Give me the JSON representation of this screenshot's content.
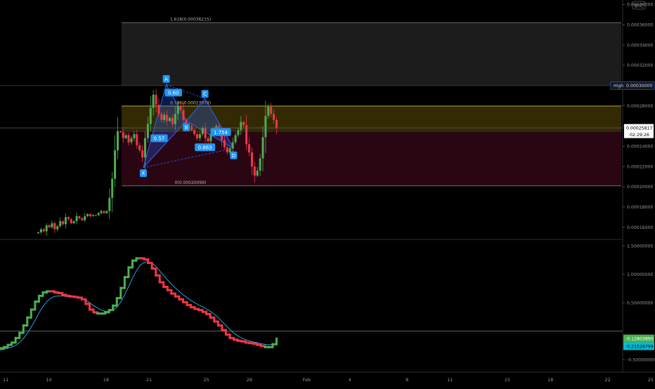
{
  "chart_data": [
    {
      "type": "candlestick",
      "panel": "price",
      "currency_badge": "BTC",
      "y_ticks": [
        "0.00038000",
        "0.00036000",
        "0.00034000",
        "0.00032000",
        "0.00028000",
        "0.00026000",
        "0.00024000",
        "0.00022000",
        "0.00020000",
        "0.00018000",
        "0.00016000"
      ],
      "ylim": [
        0.000148,
        0.0003845
      ],
      "grid": false,
      "current_price": "0.00025817",
      "current_value": 0.00025817,
      "countdown": "02:29:26",
      "high_label": "High",
      "high_price": "0.00030000",
      "high_value": 0.0003,
      "fib_levels": [
        {
          "label": "1.618(0.00036215)",
          "value": 0.00036215
        },
        {
          "label": "0.786(0.00027978)",
          "value": 0.00027978
        },
        {
          "label": "0(0.00020099)",
          "value": 0.00020099
        }
      ],
      "harmonic_points": [
        {
          "label": "X",
          "x": 20.6,
          "y": 0.000219
        },
        {
          "label": "A",
          "x": 22.2,
          "y": 0.000301
        },
        {
          "label": "B",
          "x": 23.6,
          "y": 0.000265
        },
        {
          "label": "C",
          "x": 24.9,
          "y": 0.000287
        },
        {
          "label": "D",
          "x": 26.9,
          "y": 0.000238
        }
      ],
      "harmonic_ratios": [
        {
          "label": "0.60",
          "x": 22.7,
          "y": 0.000293
        },
        {
          "label": "0.57",
          "x": 21.7,
          "y": 0.000248
        },
        {
          "label": "0.863",
          "x": 24.9,
          "y": 0.000239
        },
        {
          "label": "1.754",
          "x": 26.0,
          "y": 0.000254
        }
      ],
      "closes": [
        0.000155,
        0.000158,
        0.000156,
        0.000162,
        0.00016,
        0.000164,
        0.000158,
        0.000161,
        0.000166,
        0.000163,
        0.00017,
        0.000168,
        0.000164,
        0.000166,
        0.000171,
        0.000169,
        0.000167,
        0.000171,
        0.000173,
        0.000171,
        0.000172,
        0.000172,
        0.000174,
        0.000176,
        0.000174,
        0.000176,
        0.000189,
        0.000208,
        0.000236,
        0.000255,
        0.000254,
        0.000248,
        0.000251,
        0.000244,
        0.000248,
        0.000252,
        0.000241,
        0.000236,
        0.000229,
        0.000248,
        0.000262,
        0.000278,
        0.000291,
        0.000281,
        0.000272,
        0.000266,
        0.000271,
        0.000265,
        0.000268,
        0.000262,
        0.000272,
        0.00028,
        0.000276,
        0.000266,
        0.000261,
        0.00026,
        0.000256,
        0.000252,
        0.000248,
        0.000252,
        0.000258,
        0.000248,
        0.000245,
        0.000252,
        0.000257,
        0.00026,
        0.000254,
        0.000246,
        0.000239,
        0.000234,
        0.000238,
        0.000244,
        0.000251,
        0.000256,
        0.000264,
        0.000261,
        0.000242,
        0.000234,
        0.00022,
        0.000211,
        0.000216,
        0.000228,
        0.000249,
        0.00027,
        0.000279,
        0.000272,
        0.000266,
        0.000258
      ]
    },
    {
      "type": "line",
      "panel": "oscillator",
      "y_ticks": [
        "1.50000000",
        "1.00000000",
        "0.50000000",
        "-0.50000000"
      ],
      "ylim": [
        -0.72,
        1.6
      ],
      "zero_value": 0,
      "series": [
        {
          "role": "main",
          "color_up": "#4caf50",
          "color_down": "#f23645",
          "values": [
            -0.3,
            -0.28,
            -0.24,
            -0.2,
            -0.12,
            -0.03,
            0.1,
            0.24,
            0.38,
            0.52,
            0.62,
            0.68,
            0.7,
            0.7,
            0.68,
            0.67,
            0.64,
            0.62,
            0.61,
            0.6,
            0.59,
            0.56,
            0.48,
            0.38,
            0.33,
            0.31,
            0.31,
            0.33,
            0.37,
            0.45,
            0.58,
            0.76,
            0.95,
            1.12,
            1.24,
            1.28,
            1.28,
            1.26,
            1.2,
            1.1,
            0.98,
            0.86,
            0.78,
            0.72,
            0.66,
            0.61,
            0.56,
            0.51,
            0.46,
            0.42,
            0.39,
            0.37,
            0.34,
            0.3,
            0.24,
            0.17,
            0.1,
            0.02,
            -0.06,
            -0.12,
            -0.15,
            -0.17,
            -0.18,
            -0.2,
            -0.21,
            -0.22,
            -0.24,
            -0.26,
            -0.28,
            -0.28,
            -0.23,
            -0.13
          ]
        },
        {
          "role": "signal",
          "color": "#29b6f6",
          "values": [
            -0.33,
            -0.32,
            -0.3,
            -0.28,
            -0.25,
            -0.2,
            -0.13,
            -0.04,
            0.07,
            0.19,
            0.32,
            0.43,
            0.52,
            0.58,
            0.61,
            0.62,
            0.62,
            0.61,
            0.6,
            0.6,
            0.59,
            0.58,
            0.55,
            0.5,
            0.45,
            0.41,
            0.37,
            0.35,
            0.35,
            0.37,
            0.42,
            0.51,
            0.64,
            0.78,
            0.93,
            1.06,
            1.16,
            1.21,
            1.22,
            1.2,
            1.14,
            1.06,
            0.98,
            0.9,
            0.83,
            0.76,
            0.7,
            0.64,
            0.59,
            0.54,
            0.5,
            0.46,
            0.43,
            0.39,
            0.35,
            0.3,
            0.24,
            0.17,
            0.1,
            0.03,
            -0.03,
            -0.08,
            -0.12,
            -0.15,
            -0.17,
            -0.19,
            -0.2,
            -0.22,
            -0.23,
            -0.24,
            -0.23,
            -0.22
          ]
        }
      ],
      "last_main": "-0.12803895",
      "last_main_value": -0.128,
      "last_signal": "-0.21528799",
      "last_signal_value": -0.215
    }
  ],
  "x_axis": {
    "ticks": [
      {
        "label": "11",
        "x": 11
      },
      {
        "label": "14",
        "x": 14
      },
      {
        "label": "18",
        "x": 18
      },
      {
        "label": "21",
        "x": 21
      },
      {
        "label": "25",
        "x": 25
      },
      {
        "label": "28",
        "x": 28
      },
      {
        "label": "Feb",
        "x": 32
      },
      {
        "label": "4",
        "x": 35
      },
      {
        "label": "8",
        "x": 39
      },
      {
        "label": "11",
        "x": 42
      },
      {
        "label": "15",
        "x": 46
      },
      {
        "label": "18",
        "x": 49
      },
      {
        "label": "22",
        "x": 53
      },
      {
        "label": "25",
        "x": 56
      }
    ],
    "xlim": [
      10.6,
      56.3
    ]
  },
  "colors": {
    "background": "#000000",
    "up": "#4caf50",
    "down": "#f23645",
    "signal": "#29b6f6",
    "harmonic": "#2962ff",
    "fib_upper_band": "#1c1c1c",
    "fib_gold_band": "#5c4d0a",
    "fib_lower_band": "#2a0613",
    "text": "#9598a1",
    "axis_line": "#2a2e39"
  }
}
